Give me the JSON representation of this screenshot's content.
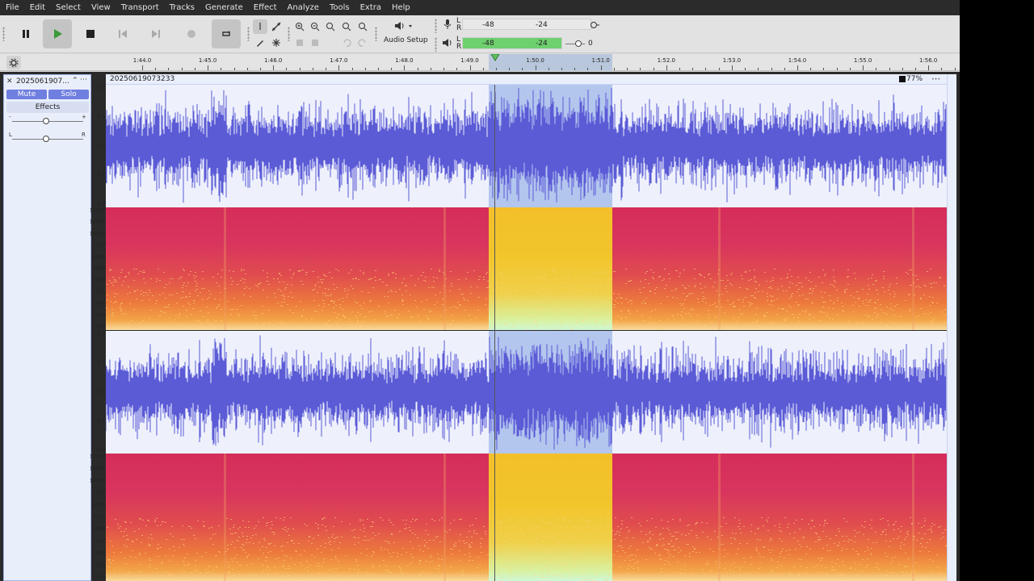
{
  "menu": [
    "File",
    "Edit",
    "Select",
    "View",
    "Transport",
    "Tracks",
    "Generate",
    "Effect",
    "Analyze",
    "Tools",
    "Extra",
    "Help"
  ],
  "toolbar": {
    "audio_setup_label": "Audio Setup",
    "rec_meter": {
      "labels": [
        "-48",
        "-24"
      ],
      "lr": [
        "L",
        "R"
      ]
    },
    "play_meter": {
      "labels": [
        "-48",
        "-24"
      ],
      "value": "0"
    }
  },
  "ruler": {
    "ticks": [
      "1:44.0",
      "1:45.0",
      "1:46.0",
      "1:47.0",
      "1:48.0",
      "1:49.0",
      "1:50.0",
      "1:51.0",
      "1:52.0",
      "1:53.0",
      "1:54.0",
      "1:55.0",
      "1:56.0"
    ]
  },
  "track": {
    "name": "20250619073233",
    "short_name": "2025061907...",
    "mute_label": "Mute",
    "solo_label": "Solo",
    "effects_label": "Effects",
    "zoom": "77%",
    "gain_minus": "-",
    "gain_plus": "+",
    "pan_left": "L",
    "pan_right": "R"
  },
  "wave_scale": [
    "1.0",
    "0.5",
    "0.0",
    "-0.5",
    "-1.0"
  ],
  "spec_scale": [
    "19000",
    "14000",
    "10000",
    "7000",
    "5000",
    "3000",
    "2000",
    "1000",
    "600",
    "330",
    "100"
  ],
  "colors": {
    "waveform": "#5b5bd6",
    "selection": "#b3c6ee",
    "mute_solo": "#6f7fe0",
    "meter_green": "#6fd06f"
  }
}
